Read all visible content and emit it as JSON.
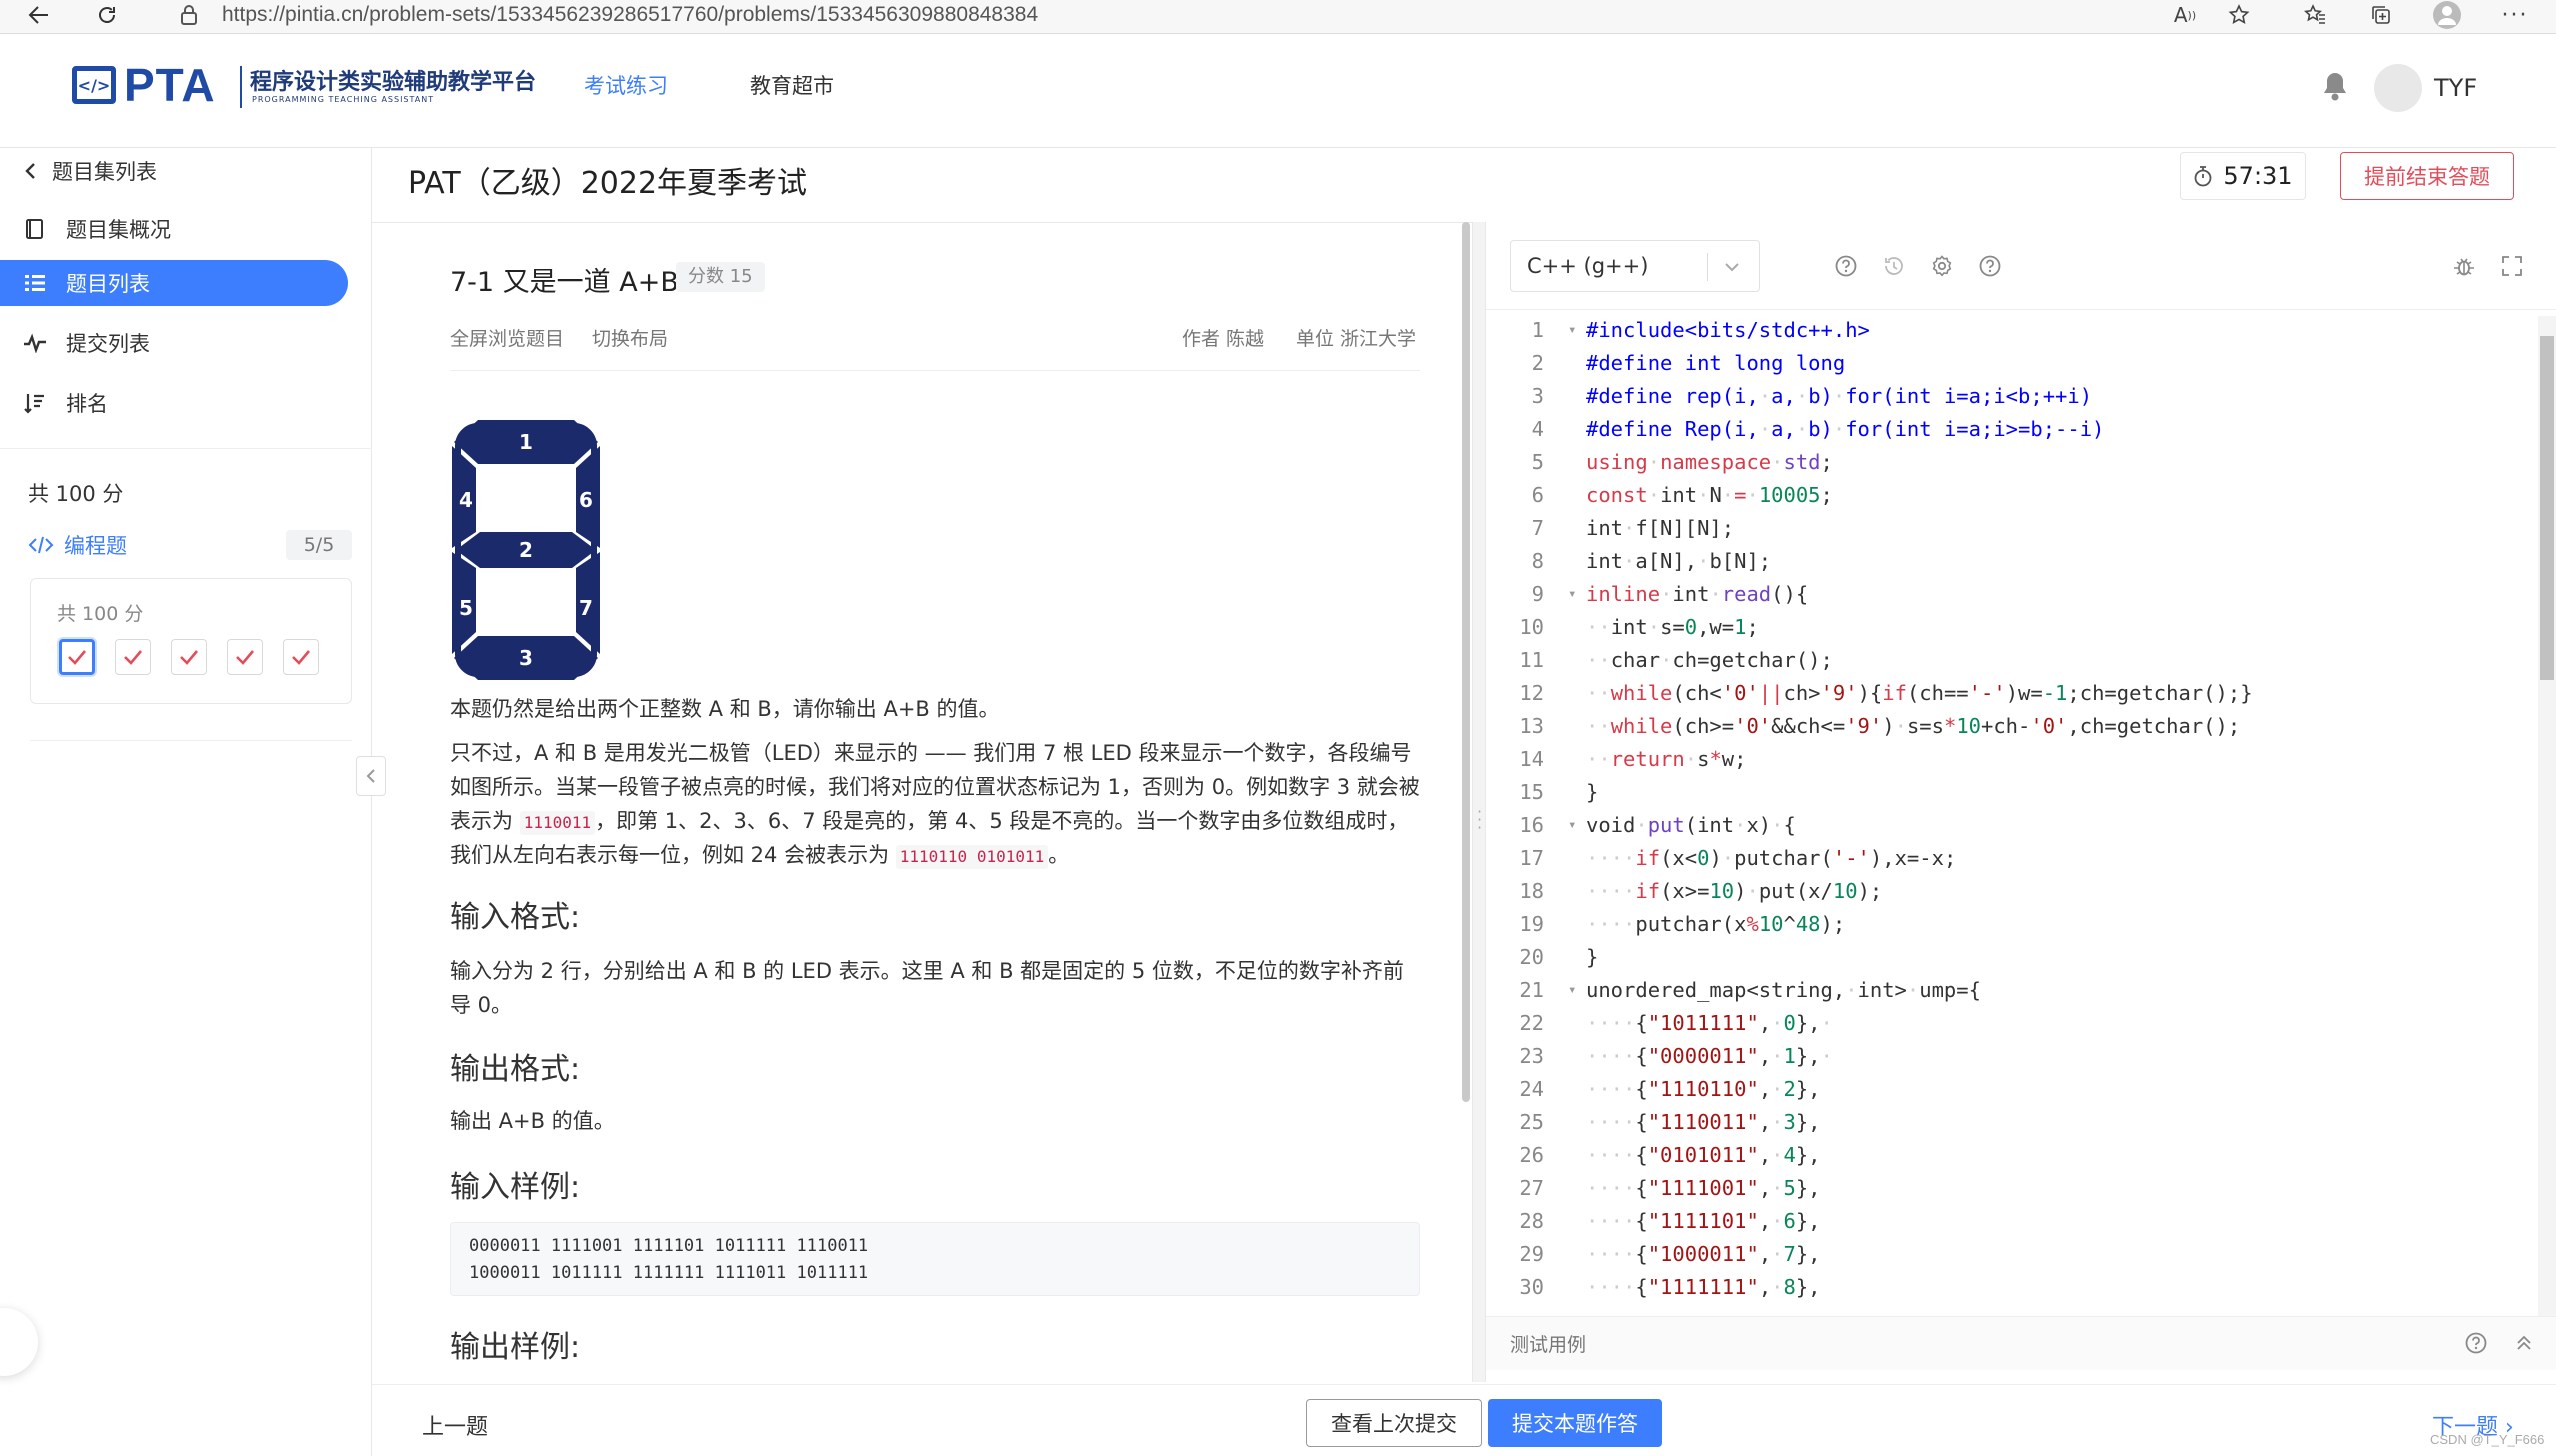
{
  "browser": {
    "url": "https://pintia.cn/problem-sets/1533456239286517760/problems/1533456309880848384"
  },
  "header": {
    "logo_text": "PTA",
    "logo_subtitle": "程序设计类实验辅助教学平台",
    "logo_en": "PROGRAMMING TEACHING ASSISTANT",
    "nav": [
      "考试练习",
      "教育超市"
    ],
    "active_nav": "考试练习",
    "user": "TYF"
  },
  "sidebar": {
    "back": "题目集列表",
    "items": [
      {
        "label": "题目集概况",
        "icon": "book-icon"
      },
      {
        "label": "题目列表",
        "icon": "list-icon",
        "active": true
      },
      {
        "label": "提交列表",
        "icon": "pulse-icon"
      },
      {
        "label": "排名",
        "icon": "rank-icon"
      }
    ],
    "total": "共 100 分",
    "category": "编程题",
    "category_progress": "5/5",
    "card_total": "共 100 分",
    "problems_done": 5
  },
  "exam": {
    "title": "PAT（乙级）2022年夏季考试",
    "timer": "57:31",
    "end_button": "提前结束答题"
  },
  "problem": {
    "title": "7-1 又是一道 A+B",
    "score": "分数 15",
    "links": [
      "全屏浏览题目",
      "切换布局"
    ],
    "author": "作者 陈越",
    "unit": "单位 浙江大学",
    "led_labels": [
      "1",
      "4",
      "6",
      "2",
      "5",
      "7",
      "3"
    ],
    "p1": "本题仍然是给出两个正整数 A 和 B，请你输出 A+B 的值。",
    "p2_a": "只不过，A 和 B 是用发光二极管（LED）来显示的 —— 我们用 7 根 LED 段来显示一个数字，各段编号如图所示。当某一段管子被点亮的时候，我们将对应的位置状态标记为 1，否则为 0。例如数字 3 就会被表示为 ",
    "p2_code1": "1110011",
    "p2_b": "，即第 1、2、3、6、7 段是亮的，第 4、5 段是不亮的。当一个数字由多位数组成时，我们从左向右表示每一位，例如 24 会被表示为 ",
    "p2_code2": "1110110 0101011",
    "p2_c": "。",
    "input_heading": "输入格式:",
    "input_desc": "输入分为 2 行，分别给出 A 和 B 的 LED 表示。这里 A 和 B 都是固定的 5 位数，不足位的数字补齐前导 0。",
    "output_heading": "输出格式:",
    "output_desc": "输出 A+B 的值。",
    "sample_in_heading": "输入样例:",
    "sample_in": "0000011 1111001 1111101 1011111 1110011\n1000011 1011111 1111111 1111011 1011111",
    "sample_out_heading": "输出样例:"
  },
  "editor": {
    "language": "C++ (g++)",
    "line_numbers": [
      "1",
      "2",
      "3",
      "4",
      "5",
      "6",
      "7",
      "8",
      "9",
      "10",
      "11",
      "12",
      "13",
      "14",
      "15",
      "16",
      "17",
      "18",
      "19",
      "20",
      "21",
      "22",
      "23",
      "24",
      "25",
      "26",
      "27",
      "28",
      "29",
      "30"
    ],
    "test_cases": "测试用例"
  },
  "footer": {
    "prev": "上一题",
    "history": "查看上次提交",
    "submit": "提交本题作答",
    "next": "下一题"
  },
  "watermark": "CSDN @T_Y_F666",
  "colors": {
    "primary": "#3d7eff",
    "danger": "#e34d59",
    "brand": "#1f4aa5",
    "led": "#1b2a6b"
  }
}
